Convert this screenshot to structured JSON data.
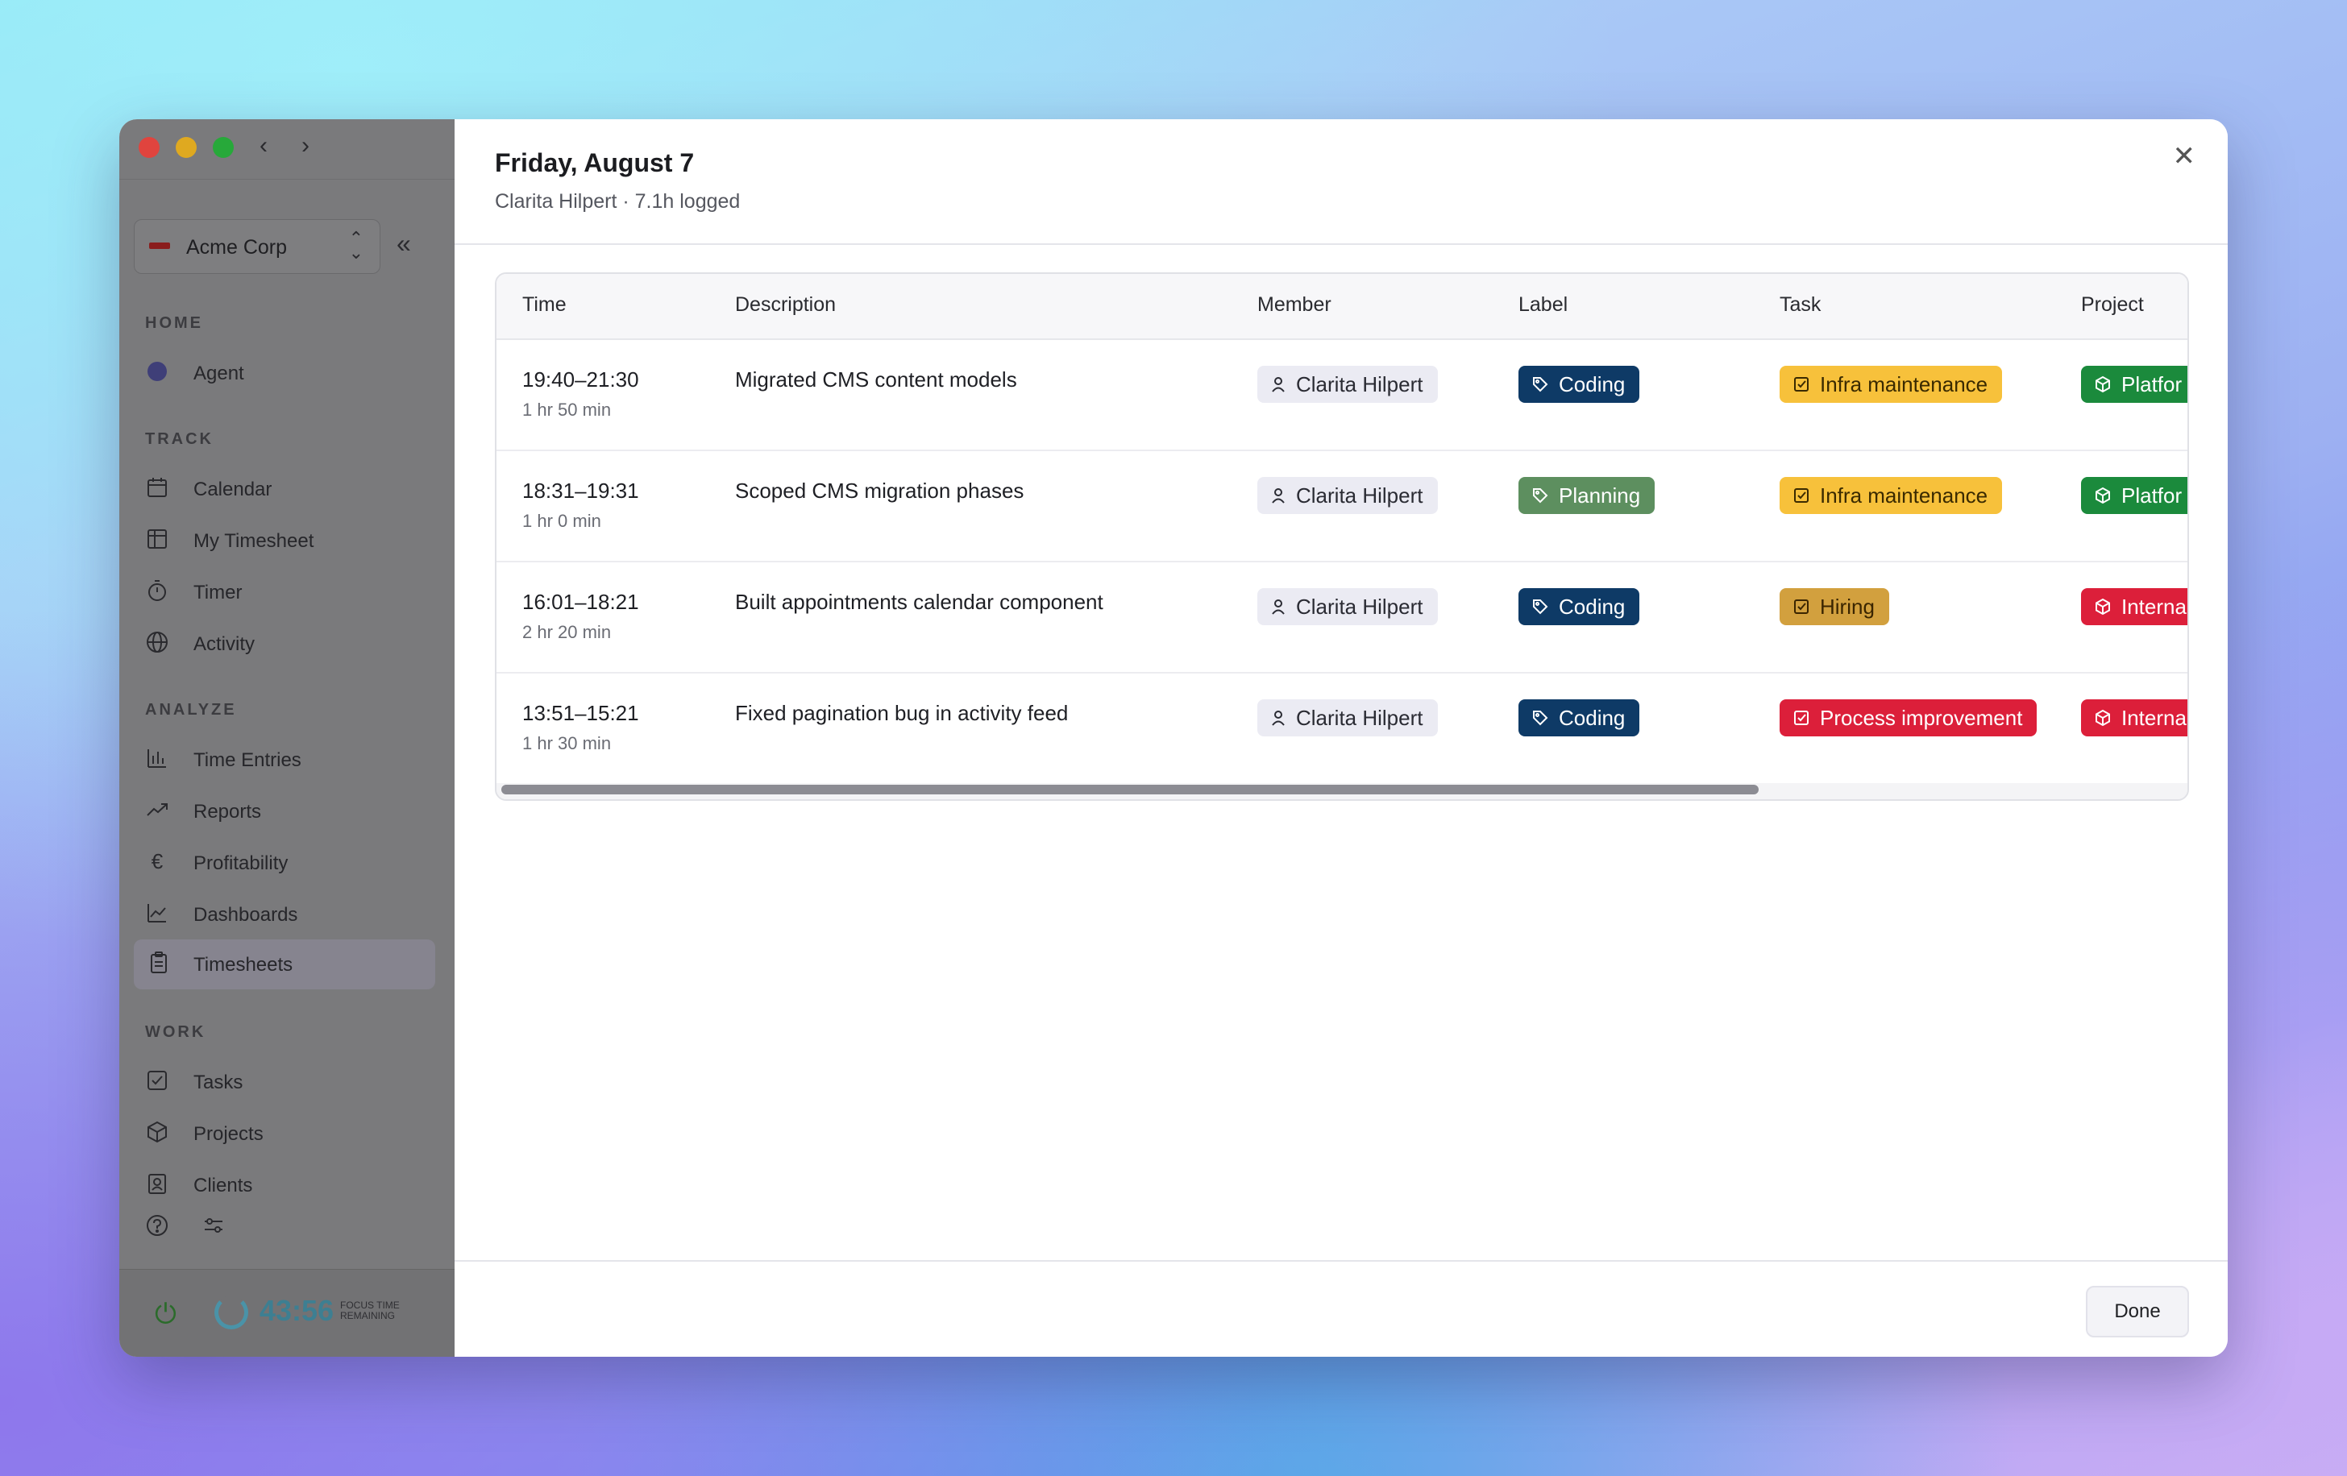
{
  "sidebar": {
    "org_name": "Acme Corp",
    "sections": {
      "home": "HOME",
      "track": "TRACK",
      "analyze": "ANALYZE",
      "work": "WORK"
    },
    "items": {
      "agent": "Agent",
      "calendar": "Calendar",
      "my_timesheet": "My Timesheet",
      "timer": "Timer",
      "activity": "Activity",
      "time_entries": "Time Entries",
      "reports": "Reports",
      "profitability": "Profitability",
      "dashboards": "Dashboards",
      "timesheets": "Timesheets",
      "tasks": "Tasks",
      "projects": "Projects",
      "clients": "Clients"
    },
    "focus_timer": "43:56",
    "focus_label_1": "FOCUS TIME",
    "focus_label_2": "REMAINING"
  },
  "modal": {
    "title": "Friday, August 7",
    "subtitle": "Clarita Hilpert · 7.1h logged",
    "done_label": "Done",
    "columns": {
      "time": "Time",
      "description": "Description",
      "member": "Member",
      "label": "Label",
      "task": "Task",
      "project": "Project"
    },
    "rows": [
      {
        "time": "19:40–21:30",
        "duration": "1 hr 50 min",
        "description": "Migrated CMS content models",
        "member": "Clarita Hilpert",
        "label": "Coding",
        "task": "Infra maintenance",
        "project": "Platfor"
      },
      {
        "time": "18:31–19:31",
        "duration": "1 hr 0 min",
        "description": "Scoped CMS migration phases",
        "member": "Clarita Hilpert",
        "label": "Planning",
        "task": "Infra maintenance",
        "project": "Platfor"
      },
      {
        "time": "16:01–18:21",
        "duration": "2 hr 20 min",
        "description": "Built appointments calendar component",
        "member": "Clarita Hilpert",
        "label": "Coding",
        "task": "Hiring",
        "project": "Interna"
      },
      {
        "time": "13:51–15:21",
        "duration": "1 hr 30 min",
        "description": "Fixed pagination bug in activity feed",
        "member": "Clarita Hilpert",
        "label": "Coding",
        "task": "Process improvement",
        "project": "Interna"
      }
    ]
  },
  "colors": {
    "coding": "#0e3a66",
    "planning": "#5d8f5f",
    "infra_maintenance": "#f7c13b",
    "hiring": "#d2a03e",
    "process_improvement": "#dc1f3a",
    "platform": "#1b8a3c",
    "internal": "#dc1f3a"
  }
}
